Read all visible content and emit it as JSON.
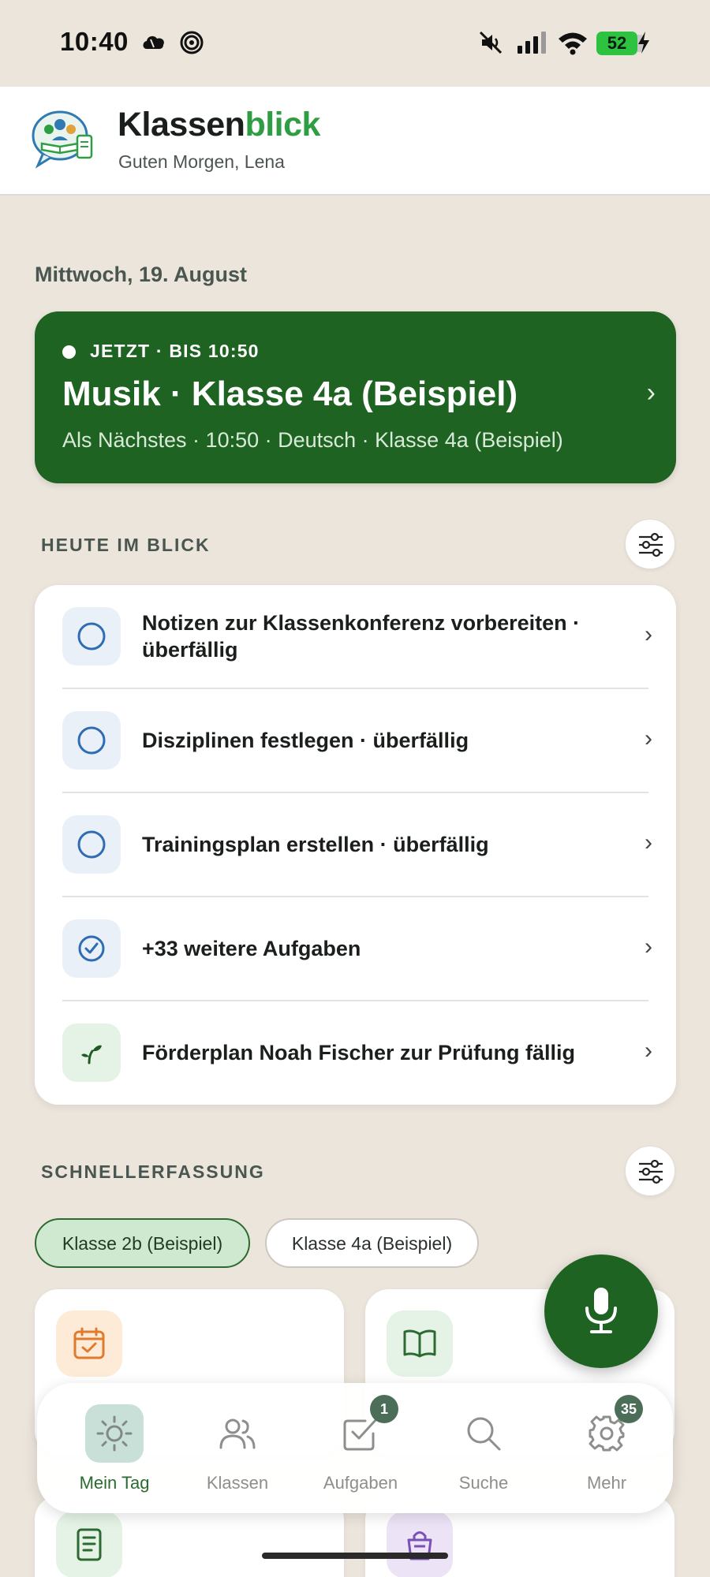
{
  "status_bar": {
    "time": "10:40",
    "battery": "52",
    "icons": [
      "cloud-icon",
      "spiral-icon",
      "mute-icon",
      "signal-icon",
      "wifi-icon",
      "battery-icon",
      "charging-icon"
    ]
  },
  "header": {
    "title_main": "Klassen",
    "title_accent": "blick",
    "greeting": "Guten Morgen, Lena",
    "accent_color": "#2e9d43"
  },
  "date": "Mittwoch, 19. August",
  "now_card": {
    "status": "JETZT · BIS 10:50",
    "title": "Musik · Klasse 4a (Beispiel)",
    "next": "Als Nächstes · 10:50 · Deutsch · Klasse 4a (Beispiel)",
    "chevron": "›",
    "color": "#1f6322"
  },
  "today": {
    "title": "HEUTE IM BLICK",
    "items": [
      {
        "icon": "circle-outline-icon",
        "label": "Notizen zur Klassenkonferenz vorbereiten · überfällig"
      },
      {
        "icon": "circle-outline-icon",
        "label": "Disziplinen festlegen · überfällig"
      },
      {
        "icon": "circle-outline-icon",
        "label": "Trainingsplan erstellen · überfällig"
      },
      {
        "icon": "check-circle-icon",
        "label": "+33 weitere Aufgaben"
      },
      {
        "icon": "sprout-icon",
        "label": "Förderplan Noah Fischer zur Prüfung fällig"
      }
    ],
    "chevron": "›"
  },
  "quick_capture": {
    "title": "SCHNELLERFASSUNG",
    "chips": [
      {
        "label": "Klasse 2b (Beispiel)",
        "selected": true
      },
      {
        "label": "Klasse 4a (Beispiel)",
        "selected": false
      }
    ],
    "tiles": [
      {
        "icon": "calendar-check-icon",
        "color": "#e07b2e"
      },
      {
        "icon": "book-open-icon",
        "color": "#2b6a30"
      },
      {
        "icon": "document-icon",
        "color": "#2b6a30"
      },
      {
        "icon": "bag-icon",
        "color": "#7b4fb8"
      }
    ]
  },
  "fab": {
    "icon": "microphone-icon"
  },
  "bottom_nav": {
    "items": [
      {
        "label": "Mein Tag",
        "icon": "sun-icon",
        "active": true,
        "badge": ""
      },
      {
        "label": "Klassen",
        "icon": "people-icon",
        "active": false,
        "badge": ""
      },
      {
        "label": "Aufgaben",
        "icon": "checkbox-icon",
        "active": false,
        "badge": "1"
      },
      {
        "label": "Suche",
        "icon": "search-icon",
        "active": false,
        "badge": ""
      },
      {
        "label": "Mehr",
        "icon": "gear-icon",
        "active": false,
        "badge": "35"
      }
    ]
  }
}
